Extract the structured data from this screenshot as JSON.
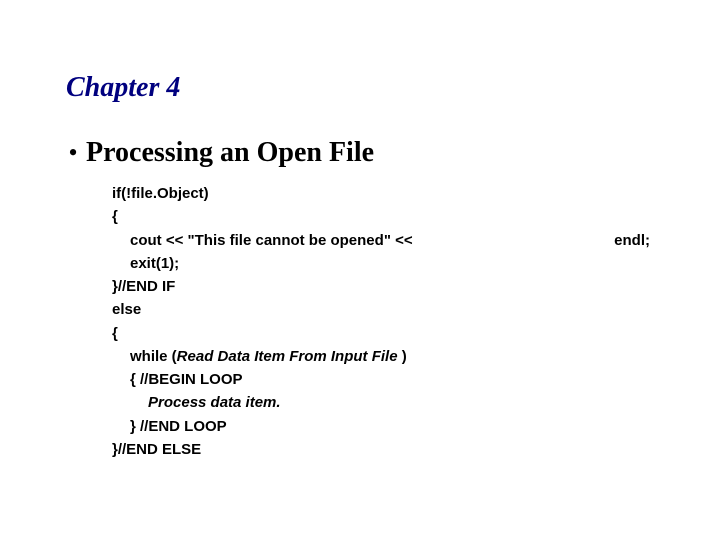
{
  "chapter": "Chapter 4",
  "heading": "Processing an Open File",
  "code": {
    "l0": "if(!file.Object)",
    "l1": "{",
    "l2_left": "cout << \"This file cannot be opened\" << ",
    "l2_right": "endl;",
    "l3": "exit(1);",
    "l4": "}//END IF",
    "l5": "else",
    "l6": "{",
    "l7a": "while (",
    "l7b": "Read Data Item From Input File ",
    "l7c": ")",
    "l8": "{ //BEGIN LOOP",
    "l9": "Process data item.",
    "l10": "} //END LOOP",
    "l11": "}//END ELSE"
  }
}
